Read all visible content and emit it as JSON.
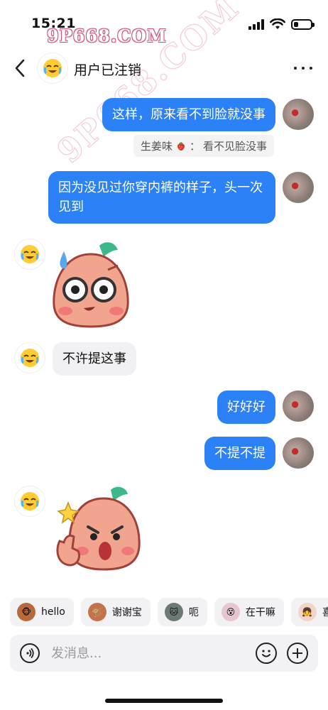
{
  "status_bar": {
    "time": "15:21",
    "watermark": "9P668.COM",
    "battery_level": 0.25
  },
  "header": {
    "title": "用户已注销"
  },
  "messages": [
    {
      "side": "right",
      "type": "text",
      "text": "这样，原来看不到脸就没事"
    },
    {
      "side": "right",
      "type": "quote",
      "author": "生姜味",
      "separator": "：",
      "text": "看不见脸没事"
    },
    {
      "side": "right",
      "type": "text",
      "text": "因为没见过你穿内裤的样子，头一次见到"
    },
    {
      "side": "left",
      "type": "sticker",
      "sticker": "peach-sweating-sticker"
    },
    {
      "side": "left",
      "type": "text",
      "text": "不许提这事"
    },
    {
      "side": "right",
      "type": "text",
      "text": "好好好"
    },
    {
      "side": "right",
      "type": "text",
      "text": "不提不提"
    },
    {
      "side": "left",
      "type": "sticker",
      "sticker": "peach-thumbs-up-sticker"
    }
  ],
  "quick_stickers": [
    {
      "label": "hello",
      "icon": "monkey-icon"
    },
    {
      "label": "谢谢宝",
      "icon": "monkey-flower-icon"
    },
    {
      "label": "呃",
      "icon": "cat-icon"
    },
    {
      "label": "在干嘛",
      "icon": "cartoon-face-icon"
    },
    {
      "label": "喜欢",
      "icon": "cartoon-girl-icon"
    }
  ],
  "input": {
    "placeholder": "发消息..."
  },
  "colors": {
    "bubble_blue": "#2c81f7",
    "bubble_gray": "#f1f1f3",
    "watermark_pink": "#d4557d"
  }
}
